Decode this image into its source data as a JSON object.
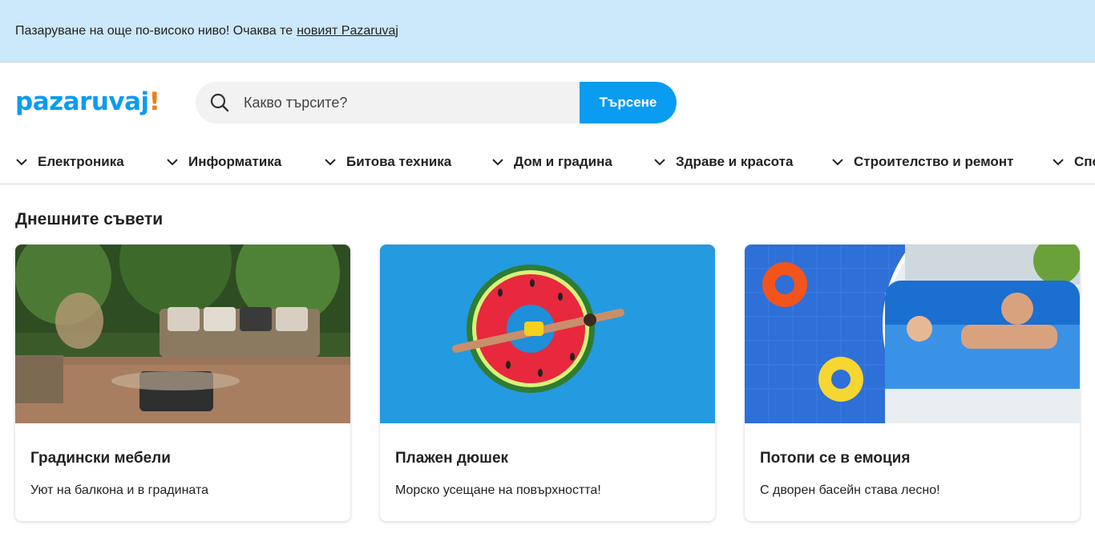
{
  "banner": {
    "text": "Пазаруване на още по-високо ниво! Очаква те",
    "link": "новият Pazaruvaj"
  },
  "header": {
    "logo": "pazaruvaj",
    "logo_mark": "!",
    "search_placeholder": "Какво търсите?",
    "search_button": "Търсене"
  },
  "nav": {
    "items": [
      {
        "label": "Електроника"
      },
      {
        "label": "Информатика"
      },
      {
        "label": "Битова техника"
      },
      {
        "label": "Дом и градина"
      },
      {
        "label": "Здраве и красота"
      },
      {
        "label": "Строителство и ремонт"
      },
      {
        "label": "Спо"
      }
    ]
  },
  "section": {
    "title": "Днешните съвети"
  },
  "cards": [
    {
      "title": "Градински мебели",
      "subtitle": "Уют на балкона и в градината"
    },
    {
      "title": "Плажен дюшек",
      "subtitle": "Морско усещане на повърхността!"
    },
    {
      "title": "Потопи се в емоция",
      "subtitle": "С дворен басейн става лесно!"
    }
  ],
  "colors": {
    "accent": "#0a9cf0",
    "logo_mark": "#f07d1a",
    "banner_bg": "#cce8fb"
  }
}
